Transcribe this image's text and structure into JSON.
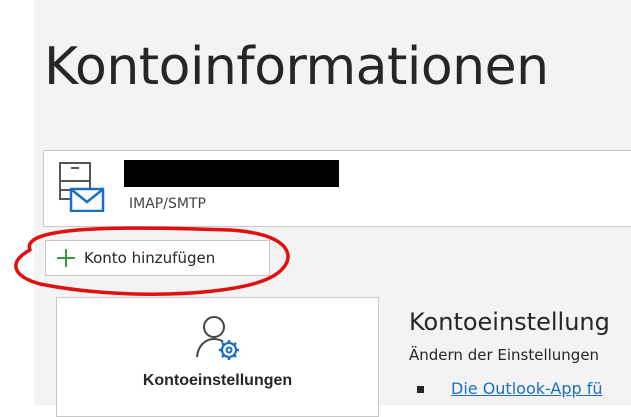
{
  "page_title": "Kontoinformationen",
  "account": {
    "type": "IMAP/SMTP"
  },
  "add_account": {
    "label": "Konto hinzufügen"
  },
  "settings_tile": {
    "label": "Kontoeinstellungen"
  },
  "section": {
    "heading": "Kontoeinstellung",
    "description": "Ändern der Einstellungen",
    "link": "Die Outlook-App fü"
  },
  "colors": {
    "panel_background": "#f3f3f3",
    "accent_blue": "#1a6fc4",
    "plus_green": "#2e9e3e",
    "annotation_red": "#e01010"
  },
  "icons": [
    "account-mail-icon",
    "plus-icon",
    "account-settings-icon",
    "bullet-icon"
  ]
}
